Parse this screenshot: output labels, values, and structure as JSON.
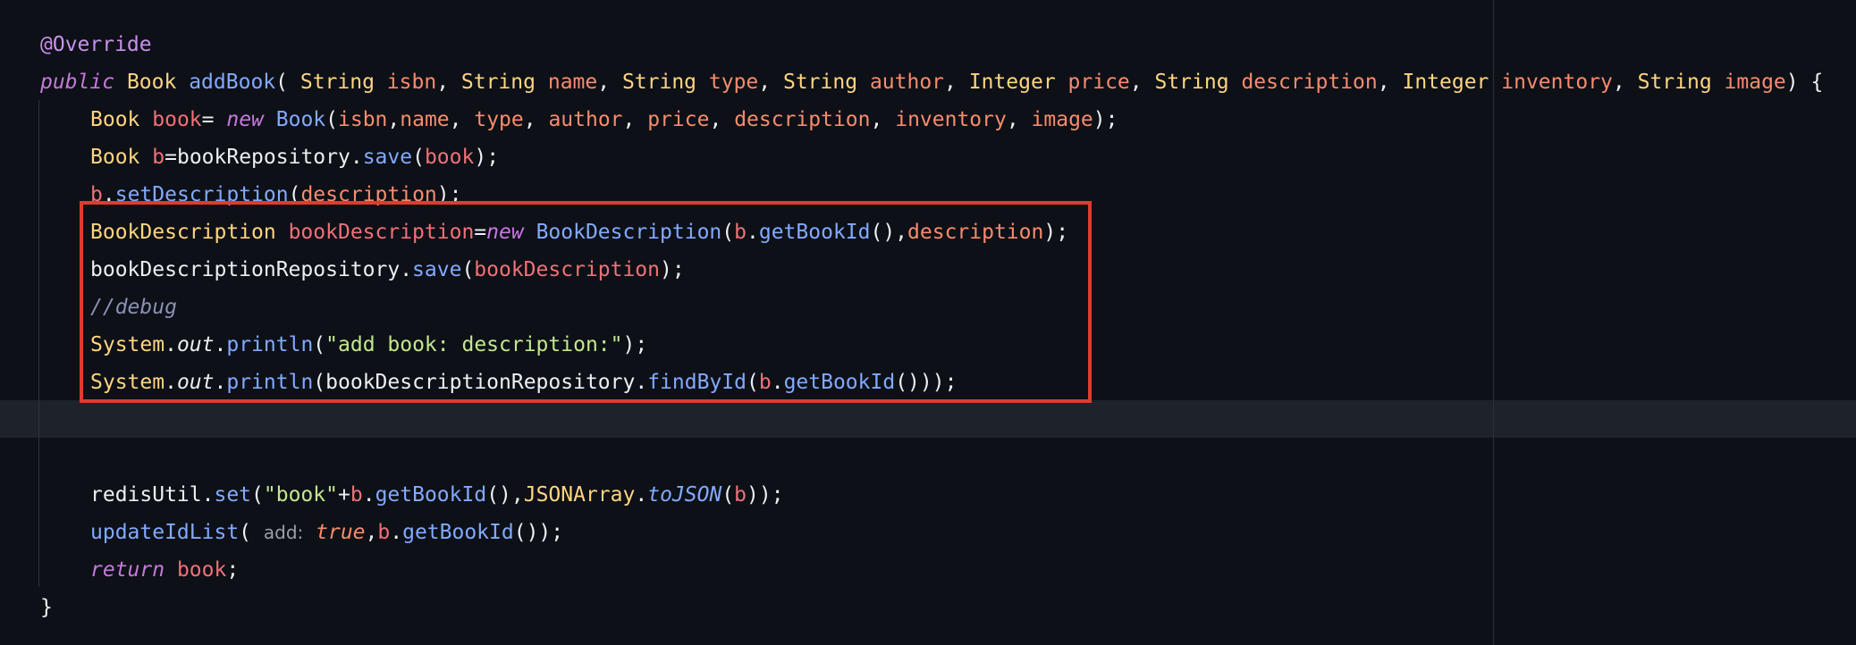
{
  "colors": {
    "background": "#0d1017",
    "current_line": "#1e232b",
    "highlight_border": "#e03c2c",
    "annotation": "#c792ea",
    "keyword": "#c678dd",
    "type": "#ffd580",
    "method": "#82aaff",
    "parameter": "#f78c6c",
    "local_variable": "#f07178",
    "string": "#c3e88d",
    "comment": "#8a91b4",
    "plain": "#eceff4",
    "hint": "#9aa0a8"
  },
  "code": {
    "lines": [
      {
        "indent": 0,
        "tokens": [
          {
            "t": "@Override",
            "c": "annotation"
          }
        ]
      },
      {
        "indent": 0,
        "tokens": [
          {
            "t": "public",
            "c": "keyword",
            "i": true
          },
          {
            "t": " ",
            "c": "plain"
          },
          {
            "t": "Book",
            "c": "type"
          },
          {
            "t": " ",
            "c": "plain"
          },
          {
            "t": "addBook",
            "c": "method"
          },
          {
            "t": "( ",
            "c": "plain"
          },
          {
            "t": "String",
            "c": "type"
          },
          {
            "t": " ",
            "c": "plain"
          },
          {
            "t": "isbn",
            "c": "parameter"
          },
          {
            "t": ", ",
            "c": "plain"
          },
          {
            "t": "String",
            "c": "type"
          },
          {
            "t": " ",
            "c": "plain"
          },
          {
            "t": "name",
            "c": "parameter"
          },
          {
            "t": ", ",
            "c": "plain"
          },
          {
            "t": "String",
            "c": "type"
          },
          {
            "t": " ",
            "c": "plain"
          },
          {
            "t": "type",
            "c": "parameter"
          },
          {
            "t": ", ",
            "c": "plain"
          },
          {
            "t": "String",
            "c": "type"
          },
          {
            "t": " ",
            "c": "plain"
          },
          {
            "t": "author",
            "c": "parameter"
          },
          {
            "t": ", ",
            "c": "plain"
          },
          {
            "t": "Integer",
            "c": "type"
          },
          {
            "t": " ",
            "c": "plain"
          },
          {
            "t": "price",
            "c": "parameter"
          },
          {
            "t": ", ",
            "c": "plain"
          },
          {
            "t": "String",
            "c": "type"
          },
          {
            "t": " ",
            "c": "plain"
          },
          {
            "t": "description",
            "c": "parameter"
          },
          {
            "t": ", ",
            "c": "plain"
          },
          {
            "t": "Integer",
            "c": "type"
          },
          {
            "t": " ",
            "c": "plain"
          },
          {
            "t": "inventory",
            "c": "parameter"
          },
          {
            "t": ", ",
            "c": "plain"
          },
          {
            "t": "String",
            "c": "type"
          },
          {
            "t": " ",
            "c": "plain"
          },
          {
            "t": "image",
            "c": "parameter"
          },
          {
            "t": ") {",
            "c": "plain"
          }
        ]
      },
      {
        "indent": 1,
        "tokens": [
          {
            "t": "Book",
            "c": "type"
          },
          {
            "t": " ",
            "c": "plain"
          },
          {
            "t": "book",
            "c": "local_variable"
          },
          {
            "t": "= ",
            "c": "plain"
          },
          {
            "t": "new",
            "c": "keyword",
            "i": true
          },
          {
            "t": " ",
            "c": "plain"
          },
          {
            "t": "Book",
            "c": "method"
          },
          {
            "t": "(",
            "c": "plain"
          },
          {
            "t": "isbn",
            "c": "parameter"
          },
          {
            "t": ",",
            "c": "plain"
          },
          {
            "t": "name",
            "c": "parameter"
          },
          {
            "t": ", ",
            "c": "plain"
          },
          {
            "t": "type",
            "c": "parameter"
          },
          {
            "t": ", ",
            "c": "plain"
          },
          {
            "t": "author",
            "c": "parameter"
          },
          {
            "t": ", ",
            "c": "plain"
          },
          {
            "t": "price",
            "c": "parameter"
          },
          {
            "t": ", ",
            "c": "plain"
          },
          {
            "t": "description",
            "c": "parameter"
          },
          {
            "t": ", ",
            "c": "plain"
          },
          {
            "t": "inventory",
            "c": "parameter"
          },
          {
            "t": ", ",
            "c": "plain"
          },
          {
            "t": "image",
            "c": "parameter"
          },
          {
            "t": ");",
            "c": "plain"
          }
        ]
      },
      {
        "indent": 1,
        "tokens": [
          {
            "t": "Book",
            "c": "type"
          },
          {
            "t": " ",
            "c": "plain"
          },
          {
            "t": "b",
            "c": "local_variable"
          },
          {
            "t": "=",
            "c": "plain"
          },
          {
            "t": "bookRepository",
            "c": "plain"
          },
          {
            "t": ".",
            "c": "plain"
          },
          {
            "t": "save",
            "c": "method"
          },
          {
            "t": "(",
            "c": "plain"
          },
          {
            "t": "book",
            "c": "local_variable"
          },
          {
            "t": ");",
            "c": "plain"
          }
        ]
      },
      {
        "indent": 1,
        "tokens": [
          {
            "t": "b",
            "c": "local_variable"
          },
          {
            "t": ".",
            "c": "plain"
          },
          {
            "t": "setDescription",
            "c": "method"
          },
          {
            "t": "(",
            "c": "plain"
          },
          {
            "t": "description",
            "c": "parameter"
          },
          {
            "t": ");",
            "c": "plain"
          }
        ]
      },
      {
        "indent": 1,
        "tokens": [
          {
            "t": "BookDescription",
            "c": "type"
          },
          {
            "t": " ",
            "c": "plain"
          },
          {
            "t": "bookDescription",
            "c": "local_variable"
          },
          {
            "t": "=",
            "c": "plain"
          },
          {
            "t": "new",
            "c": "keyword",
            "i": true
          },
          {
            "t": " ",
            "c": "plain"
          },
          {
            "t": "BookDescription",
            "c": "method"
          },
          {
            "t": "(",
            "c": "plain"
          },
          {
            "t": "b",
            "c": "local_variable"
          },
          {
            "t": ".",
            "c": "plain"
          },
          {
            "t": "getBookId",
            "c": "method"
          },
          {
            "t": "(),",
            "c": "plain"
          },
          {
            "t": "description",
            "c": "parameter"
          },
          {
            "t": ");",
            "c": "plain"
          }
        ]
      },
      {
        "indent": 1,
        "tokens": [
          {
            "t": "bookDescriptionRepository",
            "c": "plain"
          },
          {
            "t": ".",
            "c": "plain"
          },
          {
            "t": "save",
            "c": "method"
          },
          {
            "t": "(",
            "c": "plain"
          },
          {
            "t": "bookDescription",
            "c": "local_variable"
          },
          {
            "t": ");",
            "c": "plain"
          }
        ]
      },
      {
        "indent": 1,
        "tokens": [
          {
            "t": "//debug",
            "c": "comment",
            "i": true
          }
        ]
      },
      {
        "indent": 1,
        "tokens": [
          {
            "t": "System",
            "c": "type"
          },
          {
            "t": ".",
            "c": "plain"
          },
          {
            "t": "out",
            "c": "plain",
            "i": true
          },
          {
            "t": ".",
            "c": "plain"
          },
          {
            "t": "println",
            "c": "method"
          },
          {
            "t": "(",
            "c": "plain"
          },
          {
            "t": "\"add book: description:\"",
            "c": "string"
          },
          {
            "t": ");",
            "c": "plain"
          }
        ]
      },
      {
        "indent": 1,
        "tokens": [
          {
            "t": "System",
            "c": "type"
          },
          {
            "t": ".",
            "c": "plain"
          },
          {
            "t": "out",
            "c": "plain",
            "i": true
          },
          {
            "t": ".",
            "c": "plain"
          },
          {
            "t": "println",
            "c": "method"
          },
          {
            "t": "(",
            "c": "plain"
          },
          {
            "t": "bookDescriptionRepository",
            "c": "plain"
          },
          {
            "t": ".",
            "c": "plain"
          },
          {
            "t": "findById",
            "c": "method"
          },
          {
            "t": "(",
            "c": "plain"
          },
          {
            "t": "b",
            "c": "local_variable"
          },
          {
            "t": ".",
            "c": "plain"
          },
          {
            "t": "getBookId",
            "c": "method"
          },
          {
            "t": "()));",
            "c": "plain"
          }
        ]
      },
      {
        "indent": 1,
        "tokens": []
      },
      {
        "indent": 1,
        "tokens": []
      },
      {
        "indent": 1,
        "tokens": [
          {
            "t": "redisUtil",
            "c": "plain"
          },
          {
            "t": ".",
            "c": "plain"
          },
          {
            "t": "set",
            "c": "method"
          },
          {
            "t": "(",
            "c": "plain"
          },
          {
            "t": "\"book\"",
            "c": "string"
          },
          {
            "t": "+",
            "c": "plain"
          },
          {
            "t": "b",
            "c": "local_variable"
          },
          {
            "t": ".",
            "c": "plain"
          },
          {
            "t": "getBookId",
            "c": "method"
          },
          {
            "t": "(),",
            "c": "plain"
          },
          {
            "t": "JSONArray",
            "c": "type"
          },
          {
            "t": ".",
            "c": "plain"
          },
          {
            "t": "toJSON",
            "c": "method",
            "i": true
          },
          {
            "t": "(",
            "c": "plain"
          },
          {
            "t": "b",
            "c": "local_variable"
          },
          {
            "t": "));",
            "c": "plain"
          }
        ]
      },
      {
        "indent": 1,
        "tokens": [
          {
            "t": "updateIdList",
            "c": "method"
          },
          {
            "t": "( ",
            "c": "plain"
          },
          {
            "t": "add:",
            "c": "hint",
            "hint": true
          },
          {
            "t": " ",
            "c": "plain"
          },
          {
            "t": "true",
            "c": "parameter",
            "i": true
          },
          {
            "t": ",",
            "c": "plain"
          },
          {
            "t": "b",
            "c": "local_variable"
          },
          {
            "t": ".",
            "c": "plain"
          },
          {
            "t": "getBookId",
            "c": "method"
          },
          {
            "t": "());",
            "c": "plain"
          }
        ]
      },
      {
        "indent": 1,
        "tokens": [
          {
            "t": "return",
            "c": "keyword",
            "i": true
          },
          {
            "t": " ",
            "c": "plain"
          },
          {
            "t": "book",
            "c": "local_variable"
          },
          {
            "t": ";",
            "c": "plain"
          }
        ]
      },
      {
        "indent": 0,
        "tokens": [
          {
            "t": "}",
            "c": "plain"
          }
        ]
      }
    ]
  }
}
